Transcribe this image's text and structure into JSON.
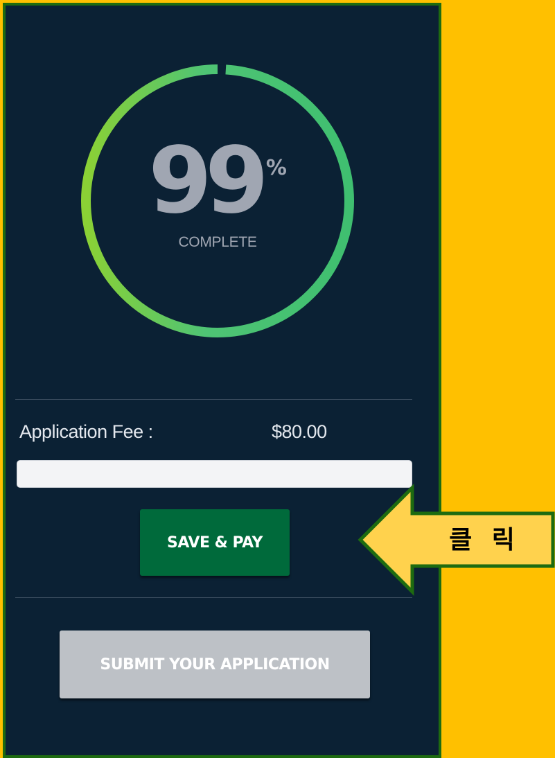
{
  "progress": {
    "percent": 99,
    "value_text": "99",
    "unit": "%",
    "status_label": "COMPLETE"
  },
  "fee": {
    "label": "Application Fee :",
    "amount": "$80.00",
    "input_value": ""
  },
  "buttons": {
    "save_pay_label": "SAVE & PAY",
    "submit_label": "SUBMIT YOUR APPLICATION"
  },
  "callout": {
    "text": "클 릭"
  },
  "colors": {
    "page_background": "#FFC000",
    "panel_background": "#0B2134",
    "panel_border": "#1E6B10",
    "ring_start": "#8BD135",
    "ring_end": "#3FBF70",
    "percent_text": "#A0A6B2",
    "save_pay_button": "#006A3B",
    "submit_button_disabled": "#BDC1C6",
    "callout_fill": "#FFD24D",
    "callout_stroke": "#1E6B10"
  }
}
